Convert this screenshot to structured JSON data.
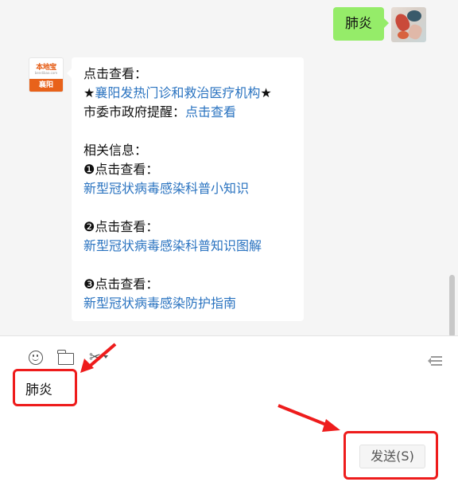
{
  "chat": {
    "sent_message": "肺炎",
    "bot_avatar": {
      "logo_text": "本地宝",
      "logo_sub": "bendibao.com",
      "city": "襄阳"
    },
    "reply_lines": [
      {
        "text": "点击查看：",
        "link": false
      },
      {
        "parts": [
          {
            "text": "★",
            "link": false
          },
          {
            "text": "襄阳发热门诊和救治医疗机构",
            "link": true
          },
          {
            "text": "★",
            "link": false
          }
        ]
      },
      {
        "parts": [
          {
            "text": "市委市政府提醒：",
            "link": false
          },
          {
            "text": "点击查看",
            "link": true
          }
        ]
      },
      {
        "gap": true
      },
      {
        "text": "相关信息：",
        "link": false
      },
      {
        "text": "❶点击查看：",
        "link": false
      },
      {
        "text": "新型冠状病毒感染科普小知识",
        "link": true
      },
      {
        "gap": true
      },
      {
        "text": "❷点击查看：",
        "link": false
      },
      {
        "text": "新型冠状病毒感染科普知识图解",
        "link": true
      },
      {
        "gap": true
      },
      {
        "text": "❸点击查看：",
        "link": false
      },
      {
        "text": "新型冠状病毒感染防护指南",
        "link": true
      }
    ]
  },
  "toolbar": {
    "icons": [
      "smile-icon",
      "folder-icon",
      "scissors-icon",
      "chevron-down-icon",
      "chat-history-icon"
    ]
  },
  "input": {
    "value": "肺炎"
  },
  "send_button": {
    "label": "发送(S)"
  },
  "colors": {
    "sent_bubble": "#95ec69",
    "link": "#2a73c0",
    "highlight": "#ee1c1c"
  }
}
